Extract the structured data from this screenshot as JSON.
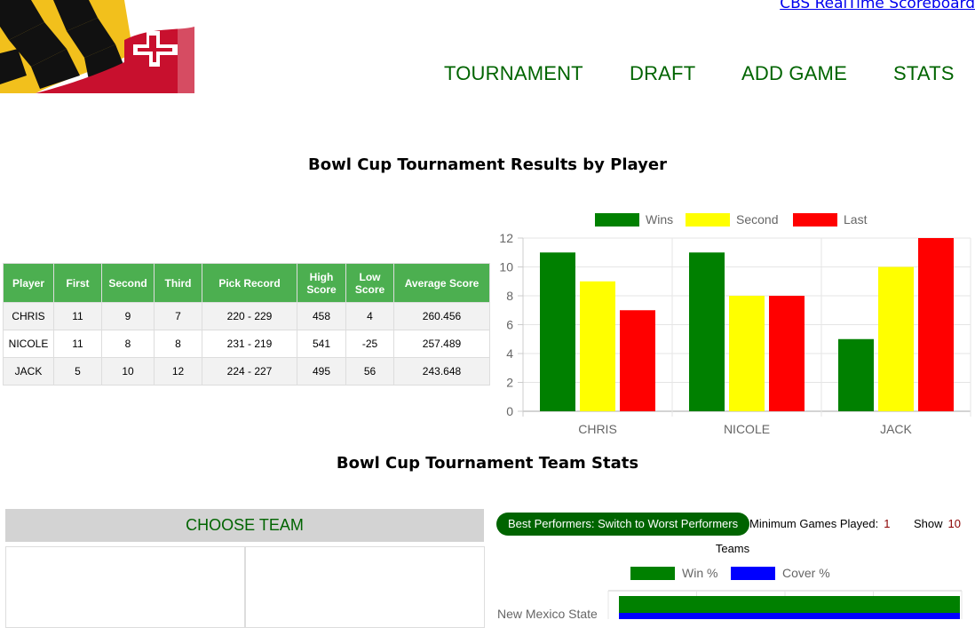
{
  "header": {
    "cbs_link": "CBS RealTime Scoreboard",
    "nav": [
      "TOURNAMENT",
      "DRAFT",
      "ADD GAME",
      "STATS"
    ]
  },
  "results_title": "Bowl Cup Tournament Results by Player",
  "results_table": {
    "headers": [
      "Player",
      "First",
      "Second",
      "Third",
      "Pick Record",
      "High Score",
      "Low Score",
      "Average Score"
    ],
    "rows": [
      [
        "CHRIS",
        "11",
        "9",
        "7",
        "220 - 229",
        "458",
        "4",
        "260.456"
      ],
      [
        "NICOLE",
        "11",
        "8",
        "8",
        "231 - 219",
        "541",
        "-25",
        "257.489"
      ],
      [
        "JACK",
        "5",
        "10",
        "12",
        "224 - 227",
        "495",
        "56",
        "243.648"
      ]
    ]
  },
  "chart_data": [
    {
      "type": "bar",
      "categories": [
        "CHRIS",
        "NICOLE",
        "JACK"
      ],
      "series": [
        {
          "name": "Wins",
          "values": [
            11,
            11,
            5
          ],
          "color": "#008000"
        },
        {
          "name": "Second",
          "values": [
            9,
            8,
            10
          ],
          "color": "#ffff00"
        },
        {
          "name": "Last",
          "values": [
            7,
            8,
            12
          ],
          "color": "#ff0000"
        }
      ],
      "ylim": [
        0,
        12
      ],
      "yticks": [
        0,
        2,
        4,
        6,
        8,
        10,
        12
      ],
      "legend": "top",
      "grid": true
    },
    {
      "type": "bar",
      "orientation": "horizontal",
      "title": "Teams",
      "categories": [
        "New Mexico State"
      ],
      "series": [
        {
          "name": "Win %",
          "values": [
            100
          ],
          "color": "#008000"
        },
        {
          "name": "Cover %",
          "values": [
            100
          ],
          "color": "#0000ff"
        }
      ],
      "legend": "top"
    }
  ],
  "team_stats_title": "Bowl Cup Tournament Team Stats",
  "choose_team": "CHOOSE TEAM",
  "controls": {
    "performers_button": "Best Performers: Switch to Worst Performers",
    "min_games_label": "Minimum Games Played:",
    "min_games_value": "1",
    "show_label": "Show",
    "show_value": "10"
  }
}
